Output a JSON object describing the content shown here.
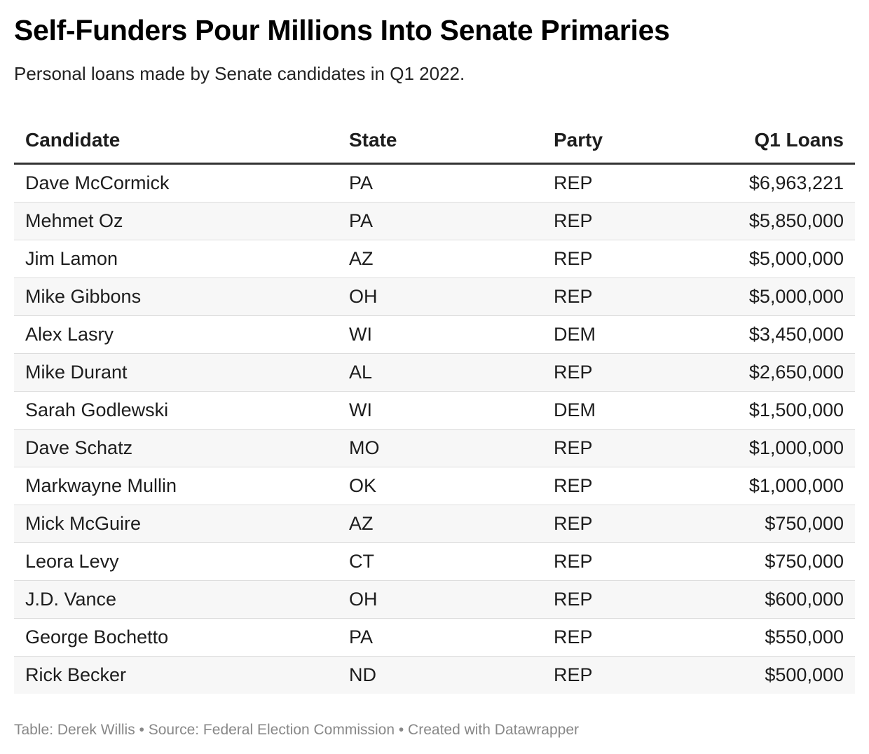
{
  "title": "Self-Funders Pour Millions Into Senate Primaries",
  "subtitle": "Personal loans made by Senate candidates in Q1 2022.",
  "footer": "Table: Derek Willis • Source: Federal Election Commission • Created with Datawrapper",
  "chart_data": {
    "type": "table",
    "columns": [
      "Candidate",
      "State",
      "Party",
      "Q1 Loans"
    ],
    "rows": [
      [
        "Dave McCormick",
        "PA",
        "REP",
        "$6,963,221"
      ],
      [
        "Mehmet Oz",
        "PA",
        "REP",
        "$5,850,000"
      ],
      [
        "Jim Lamon",
        "AZ",
        "REP",
        "$5,000,000"
      ],
      [
        "Mike Gibbons",
        "OH",
        "REP",
        "$5,000,000"
      ],
      [
        "Alex Lasry",
        "WI",
        "DEM",
        "$3,450,000"
      ],
      [
        "Mike Durant",
        "AL",
        "REP",
        "$2,650,000"
      ],
      [
        "Sarah Godlewski",
        "WI",
        "DEM",
        "$1,500,000"
      ],
      [
        "Dave Schatz",
        "MO",
        "REP",
        "$1,000,000"
      ],
      [
        "Markwayne Mullin",
        "OK",
        "REP",
        "$1,000,000"
      ],
      [
        "Mick McGuire",
        "AZ",
        "REP",
        "$750,000"
      ],
      [
        "Leora Levy",
        "CT",
        "REP",
        "$750,000"
      ],
      [
        "J.D. Vance",
        "OH",
        "REP",
        "$600,000"
      ],
      [
        "George Bochetto",
        "PA",
        "REP",
        "$550,000"
      ],
      [
        "Rick Becker",
        "ND",
        "REP",
        "$500,000"
      ]
    ]
  }
}
